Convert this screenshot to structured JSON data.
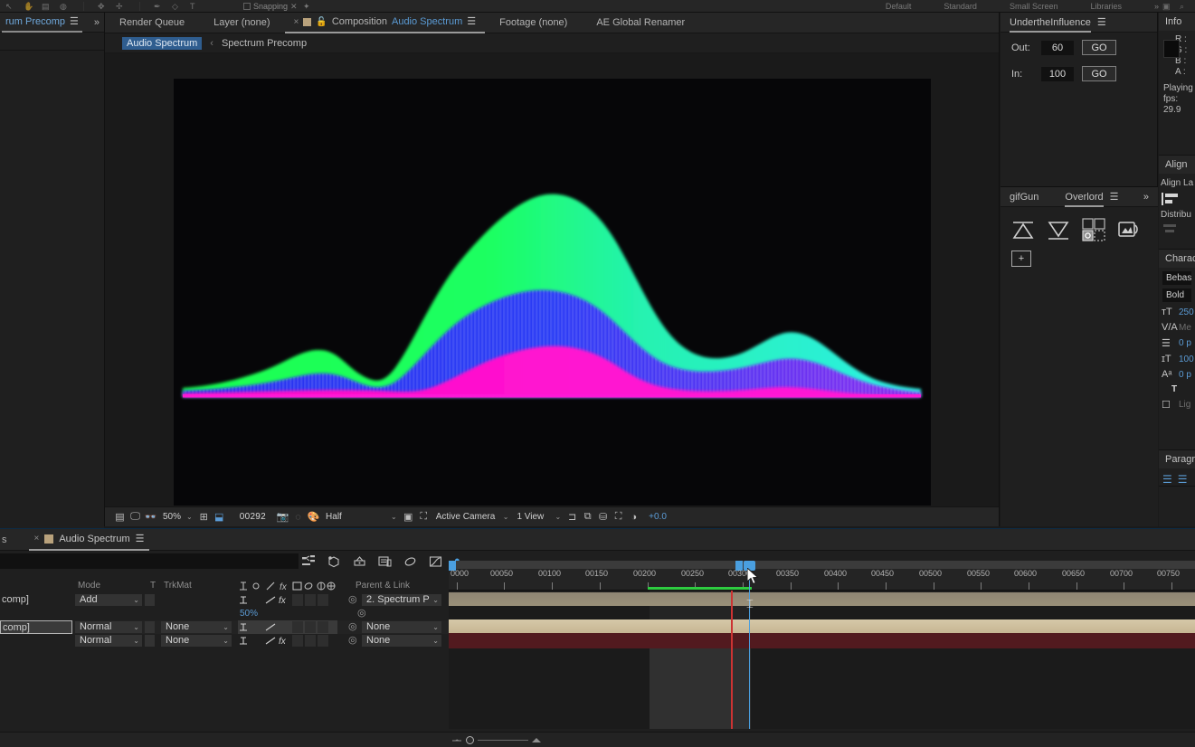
{
  "app": {
    "workspaces": [
      "Default",
      "Standard",
      "Small Screen",
      "Libraries"
    ],
    "toolbar": {
      "snapping_label": "Snapping",
      "icons": [
        "selection-tool",
        "hand-tool",
        "zoom-tool",
        "orbit-tool",
        "pan-tool",
        "dolly-tool",
        "rotation-tool",
        "anchor-point-tool",
        "shape-tool",
        "pen-tool",
        "type-tool",
        "brush-tool",
        "clone-tool",
        "eraser-tool",
        "roto-brush-tool",
        "puppet-tool"
      ]
    }
  },
  "project_panel": {
    "tab_label": "rum Precomp",
    "menu_icon": "hamburger-icon",
    "expand_icon": "chevron-double-right-icon"
  },
  "viewer": {
    "tabs": [
      {
        "label": "Render Queue",
        "active": false
      },
      {
        "label": "Layer (none)",
        "active": false
      },
      {
        "label": "Composition",
        "name": "Audio Spectrum",
        "active": true
      },
      {
        "label": "Footage (none)",
        "active": false
      },
      {
        "label": "AE Global Renamer",
        "active": false
      }
    ],
    "breadcrumbs": [
      {
        "label": "Audio Spectrum",
        "active": true
      },
      {
        "label": "Spectrum Precomp",
        "active": false
      }
    ],
    "bottom_bar": {
      "magnification": "50%",
      "timecode": "00292",
      "resolution": "Half",
      "camera": "Active Camera",
      "views": "1 View",
      "exposure": "+0.0",
      "icons": [
        "toggle-transparency-grid-icon",
        "toggle-mask-paths-icon",
        "toggle-3d-view-icon",
        "region-of-interest-icon",
        "grid-guides-icon",
        "snapshot-icon",
        "show-snapshot-icon",
        "channels-icon",
        "toggle-alpha-icon",
        "pixel-aspect-correction-icon",
        "fast-previews-icon",
        "timeline-icon",
        "comp-flowchart-icon",
        "reset-exposure-icon"
      ]
    }
  },
  "underthe_influence": {
    "title": "UndertheInfluence",
    "menu_icon": "hamburger-icon",
    "fields": [
      {
        "label": "Out:",
        "value": "60",
        "button": "GO"
      },
      {
        "label": "In:",
        "value": "100",
        "button": "GO"
      }
    ]
  },
  "extensions_panel": {
    "tabs": [
      {
        "label": "gifGun",
        "active": false
      },
      {
        "label": "Overlord",
        "active": true
      }
    ],
    "menu_icon": "hamburger-icon",
    "more_icon": "chevron-double-right-icon",
    "buttons": [
      "send-to-illustrator-icon",
      "send-to-after-effects-icon",
      "settings-icon",
      "swap-icon",
      "duplicate-icon",
      "new-document-icon"
    ]
  },
  "info_panel": {
    "title": "Info",
    "channels": [
      "R :",
      "G :",
      "B :",
      "A :"
    ],
    "status": "Playing",
    "fps": "fps: 29.9"
  },
  "align_panel": {
    "title": "Align",
    "align_layers_label": "Align La",
    "distribute_label": "Distribu"
  },
  "character_panel": {
    "title": "Charac",
    "font_family": "Bebas",
    "font_style": "Bold",
    "font_size": "250",
    "kerning": "Me",
    "tracking": "0 p",
    "leading": "100",
    "baseline_shift": "0 p",
    "faux_label": "T",
    "ligatures_label": "Lig"
  },
  "paragraph_panel": {
    "title": "Paragra"
  },
  "timeline": {
    "tab_prev_label": "s",
    "tab_label": "Audio Spectrum",
    "menu_icon": "hamburger-icon",
    "search_placeholder": "",
    "tools": [
      "composition-mini-flowchart-icon",
      "draft-3d-icon",
      "hide-shy-layers-icon",
      "frame-blending-icon",
      "motion-blur-icon",
      "graph-editor-icon"
    ],
    "columns": [
      "Mode",
      "T",
      "TrkMat",
      "Parent & Link"
    ],
    "switch_icons": [
      "shy-icon",
      "collapse-transformations-icon",
      "quality-icon",
      "effects-icon",
      "frame-blending-icon",
      "motion-blur-icon",
      "adjustment-layer-icon",
      "3d-layer-icon"
    ],
    "rows": [
      {
        "name": "comp]",
        "mode": "Add",
        "trkmat": "",
        "parent": "2. Spectrum P",
        "selected": false,
        "editing": false
      },
      {
        "name": "",
        "mode": "",
        "trkmat": "",
        "parent": "",
        "opacity": "50%",
        "is_property": true
      },
      {
        "name": "comp]",
        "mode": "Normal",
        "trkmat": "None",
        "parent": "None",
        "selected": true,
        "editing": true
      },
      {
        "name": "",
        "mode": "Normal",
        "trkmat": "None",
        "parent": "None",
        "selected": false,
        "editing": false
      }
    ],
    "ruler_ticks": [
      "0000",
      "00050",
      "00100",
      "00150",
      "00200",
      "00250",
      "00300",
      "00350",
      "00400",
      "00450",
      "00500",
      "00550",
      "00600",
      "00650",
      "00700",
      "00750"
    ],
    "playhead_position": 330
  },
  "colors": {
    "accent_blue": "#4a9fe0",
    "selected_tab_blue": "#2f5d8f",
    "layer_bar_tan": "#c9b896",
    "layer_bar_red": "#5c1c22",
    "workarea_green": "#2ecc40",
    "spectrum_green": "#1aff66",
    "spectrum_cyan": "#2ef0d8",
    "spectrum_blue": "#2a3cf0",
    "spectrum_magenta": "#ff14d0"
  },
  "chart_data": {
    "type": "area",
    "title": "Audio Spectrum",
    "series": [
      {
        "name": "outer-green",
        "values": [
          2,
          3,
          5,
          9,
          14,
          16,
          14,
          11,
          14,
          28,
          48,
          68,
          86,
          96,
          98,
          94,
          88,
          82,
          74,
          64,
          54,
          46,
          40,
          34,
          30,
          28,
          30,
          34,
          36,
          34,
          28,
          22,
          18,
          22,
          28,
          30,
          26,
          20,
          14,
          9,
          5
        ]
      },
      {
        "name": "mid-blue",
        "values": [
          1,
          2,
          3,
          5,
          8,
          9,
          8,
          7,
          9,
          18,
          31,
          44,
          56,
          63,
          66,
          64,
          60,
          56,
          50,
          44,
          38,
          32,
          27,
          23,
          20,
          19,
          20,
          23,
          24,
          23,
          19,
          15,
          12,
          15,
          19,
          20,
          17,
          13,
          9,
          6,
          3
        ]
      },
      {
        "name": "inner-magenta",
        "values": [
          1,
          1,
          2,
          3,
          4,
          5,
          4,
          4,
          5,
          10,
          18,
          26,
          34,
          39,
          41,
          40,
          38,
          35,
          32,
          28,
          24,
          20,
          17,
          14,
          12,
          12,
          13,
          14,
          15,
          14,
          12,
          9,
          7,
          9,
          12,
          13,
          11,
          8,
          6,
          4,
          2
        ]
      }
    ],
    "xlabel": "",
    "ylabel": "",
    "grid": false,
    "legend": "none"
  }
}
